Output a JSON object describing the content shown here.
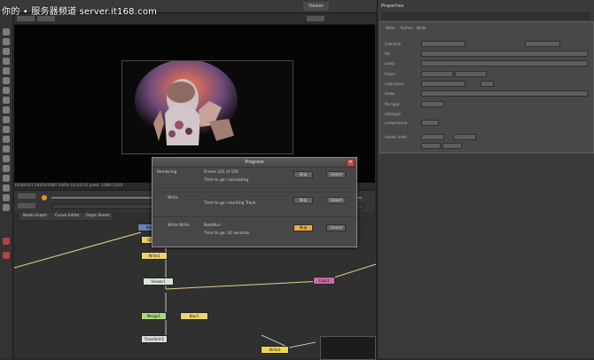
{
  "watermark": "你的 • 服务器频道 server.it168.com",
  "topbar": {
    "tabs": [
      "Viewer",
      "Properties"
    ]
  },
  "viewer": {
    "info": "RGBA32f 1920x1080 100% [0.0,0.0] pixel: 1080,1020"
  },
  "graph_tabs": [
    "Node Graph",
    "Curve Editor",
    "Dope Sheet"
  ],
  "properties": {
    "title": "Properties",
    "tabs": [
      "Write",
      "Python",
      "Node"
    ],
    "rows": [
      "channels",
      "file",
      "proxy",
      "frame",
      "colorspace",
      "views",
      "file type",
      "datatype",
      "compression",
      "render order"
    ]
  },
  "dialog": {
    "title": "Progress",
    "rows": [
      {
        "name": "Rendering",
        "line1": "Frame 101 of 150",
        "line2": "Time to go: calculating",
        "ok": "Skip",
        "cancel": "Cancel"
      },
      {
        "name": "Write",
        "line1": "Time to go: counting Track",
        "line2": "",
        "ok": "Skip",
        "cancel": "Cancel"
      },
      {
        "name": "Write Write",
        "line1": "NoteRun",
        "line2": "Time to go: 31 seconds",
        "ok": "Skip",
        "cancel": "Cancel"
      }
    ]
  },
  "nodes": [
    "Read1",
    "Grade1",
    "Write1",
    "Viewer1",
    "Merge1",
    "Blur1",
    "Transform1",
    "Write2",
    "Crop1"
  ],
  "colors": {
    "accent_orange": "#f0a93a",
    "node_yellow": "#e3c84b",
    "node_green": "#9ccf74",
    "node_pink": "#c86aa2"
  }
}
